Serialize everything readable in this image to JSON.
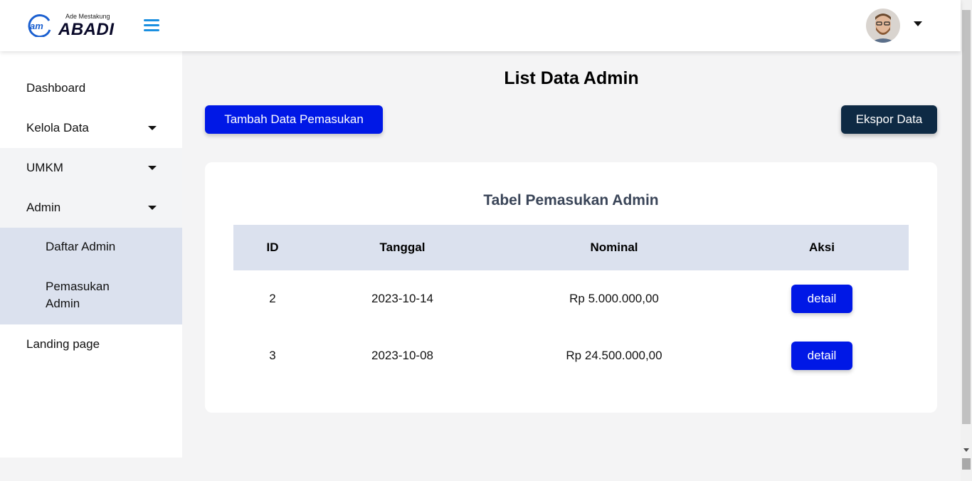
{
  "header": {
    "logo_tagline": "Ade Mestakung",
    "logo_name": "ABADI",
    "logo_mark": "am",
    "menu_icon": "hamburger-icon",
    "avatar_icon": "user-avatar",
    "accent_color": "#1a8fe0"
  },
  "sidebar": {
    "items": [
      {
        "label": "Dashboard"
      },
      {
        "label": "Kelola Data"
      },
      {
        "label": "UMKM"
      },
      {
        "label": "Admin"
      },
      {
        "label": "Landing page"
      }
    ],
    "admin_submenu": [
      {
        "label": "Daftar Admin"
      },
      {
        "label": "Pemasukan Admin"
      }
    ]
  },
  "main": {
    "title": "List Data Admin",
    "add_button": "Tambah Data Pemasukan",
    "export_button": "Ekspor Data",
    "card_title": "Tabel Pemasukan Admin",
    "table": {
      "headers": [
        "ID",
        "Tanggal",
        "Nominal",
        "Aksi"
      ],
      "rows": [
        {
          "id": "2",
          "date": "2023-10-14",
          "nominal": "Rp 5.000.000,00",
          "action": "detail"
        },
        {
          "id": "3",
          "date": "2023-10-08",
          "nominal": "Rp 24.500.000,00",
          "action": "detail"
        }
      ]
    }
  },
  "colors": {
    "primary_button": "#0018e6",
    "export_button": "#0e2a44",
    "submenu_bg": "#dbe1ee"
  }
}
